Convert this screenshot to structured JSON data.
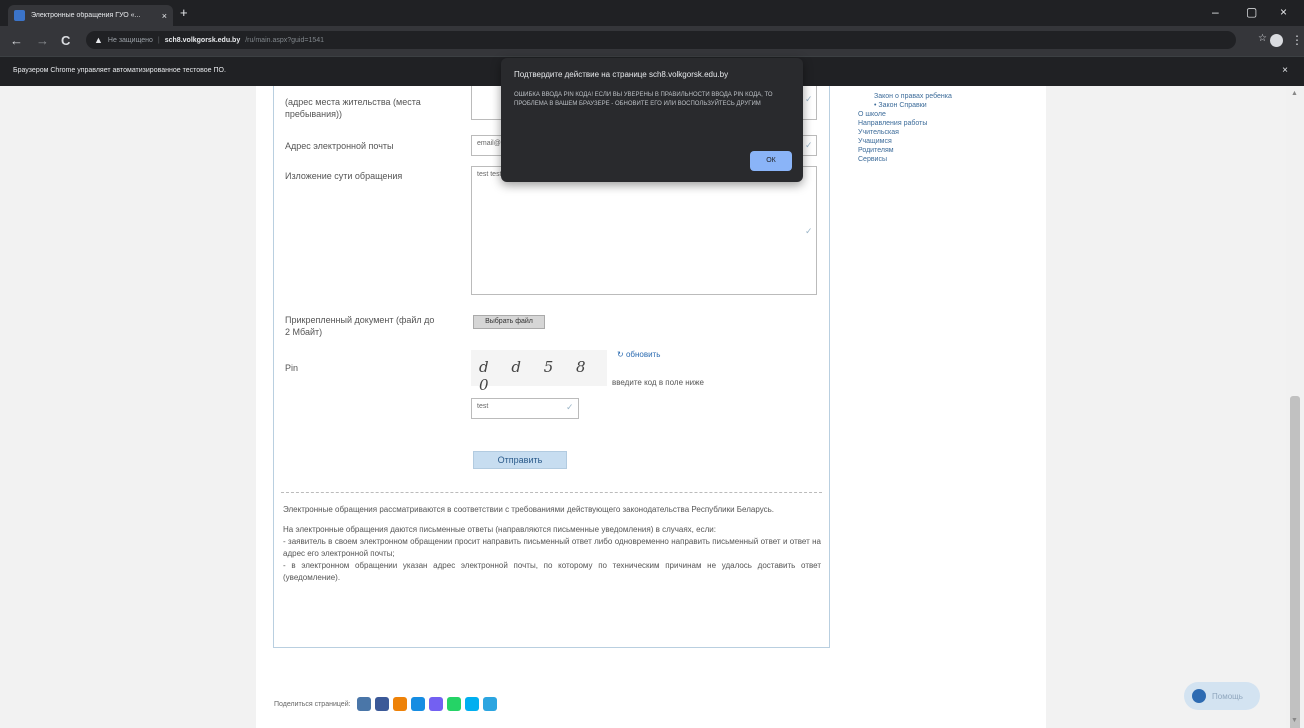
{
  "browser": {
    "tab_title": "Электронные обращения ГУО «...",
    "tab_close": "×",
    "new_tab": "+",
    "win_min": "–",
    "win_max": "▢",
    "win_close": "×",
    "back": "←",
    "forward": "→",
    "reload": "C",
    "security_label": "Не защищено",
    "url_host": "sch8.volkgorsk.edu.by",
    "url_path": "/ru/main.aspx?guid=1541",
    "bookmark_icon": "☆",
    "menu_icon": "⋮",
    "infobar_text": "Браузером Chrome управляет автоматизированное тестовое ПО.",
    "infobar_close": "×"
  },
  "dialog": {
    "title": "Подтвердите действие на странице sch8.volkgorsk.edu.by",
    "message": "ОШИБКА ВВОДА PIN КОДА! ЕСЛИ ВЫ УВЕРЕНЫ В ПРАВИЛЬНОСТИ ВВОДА PIN КОДА, ТО ПРОБЛЕМА В ВАШЕМ БРАУЗЕРЕ - ОБНОВИТЕ ЕГО ИЛИ ВОСПОЛЬЗУЙТЕСЬ ДРУГИМ",
    "ok_label": "ОК"
  },
  "form": {
    "address_label": "(адрес места жительства (места пребывания))",
    "email_label": "Адрес электронной почты",
    "email_value": "email@",
    "essence_label": "Изложение сути обращения",
    "essence_value": "test test",
    "attachment_label": "Прикрепленный документ (файл до 2 Мбайт)",
    "choose_file": "Выбрать файл",
    "pin_label": "Pin",
    "captcha_text": "d d 5 8 0",
    "refresh_label": "обновить",
    "captcha_hint": "введите код в поле ниже",
    "pin_value": "test",
    "submit_label": "Отправить",
    "check_mark": "✓"
  },
  "legal": {
    "p1": "Электронные обращения рассматриваются в соответствии с требованиями действующего законодательства Республики Беларусь.",
    "p2": "На электронные обращения даются письменные ответы (направляются письменные уведомления) в случаях, если:",
    "p3": "- заявитель в своем электронном обращении просит направить письменный ответ либо одновременно направить письменный ответ и ответ на адрес его электронной почты;",
    "p4": "- в электронном обращении указан адрес электронной почты, по которому по техническим причинам не удалось доставить ответ (уведомление)."
  },
  "share": {
    "label": "Поделиться страницей:",
    "icons": [
      "vk",
      "fb",
      "ok",
      "mail",
      "viber",
      "whatsapp",
      "skype",
      "telegram"
    ],
    "colors": [
      "#4a76a8",
      "#3b5998",
      "#ee8208",
      "#168de2",
      "#7360f2",
      "#25d366",
      "#00aff0",
      "#2ca5e0"
    ]
  },
  "sidebar": {
    "items": [
      "Закон о правах ребенка",
      "Закон Справки",
      "О школе",
      "Направления работы",
      "Учительская",
      "Учащимся",
      "Родителям",
      "Сервисы"
    ]
  },
  "help_button": "Помощь"
}
